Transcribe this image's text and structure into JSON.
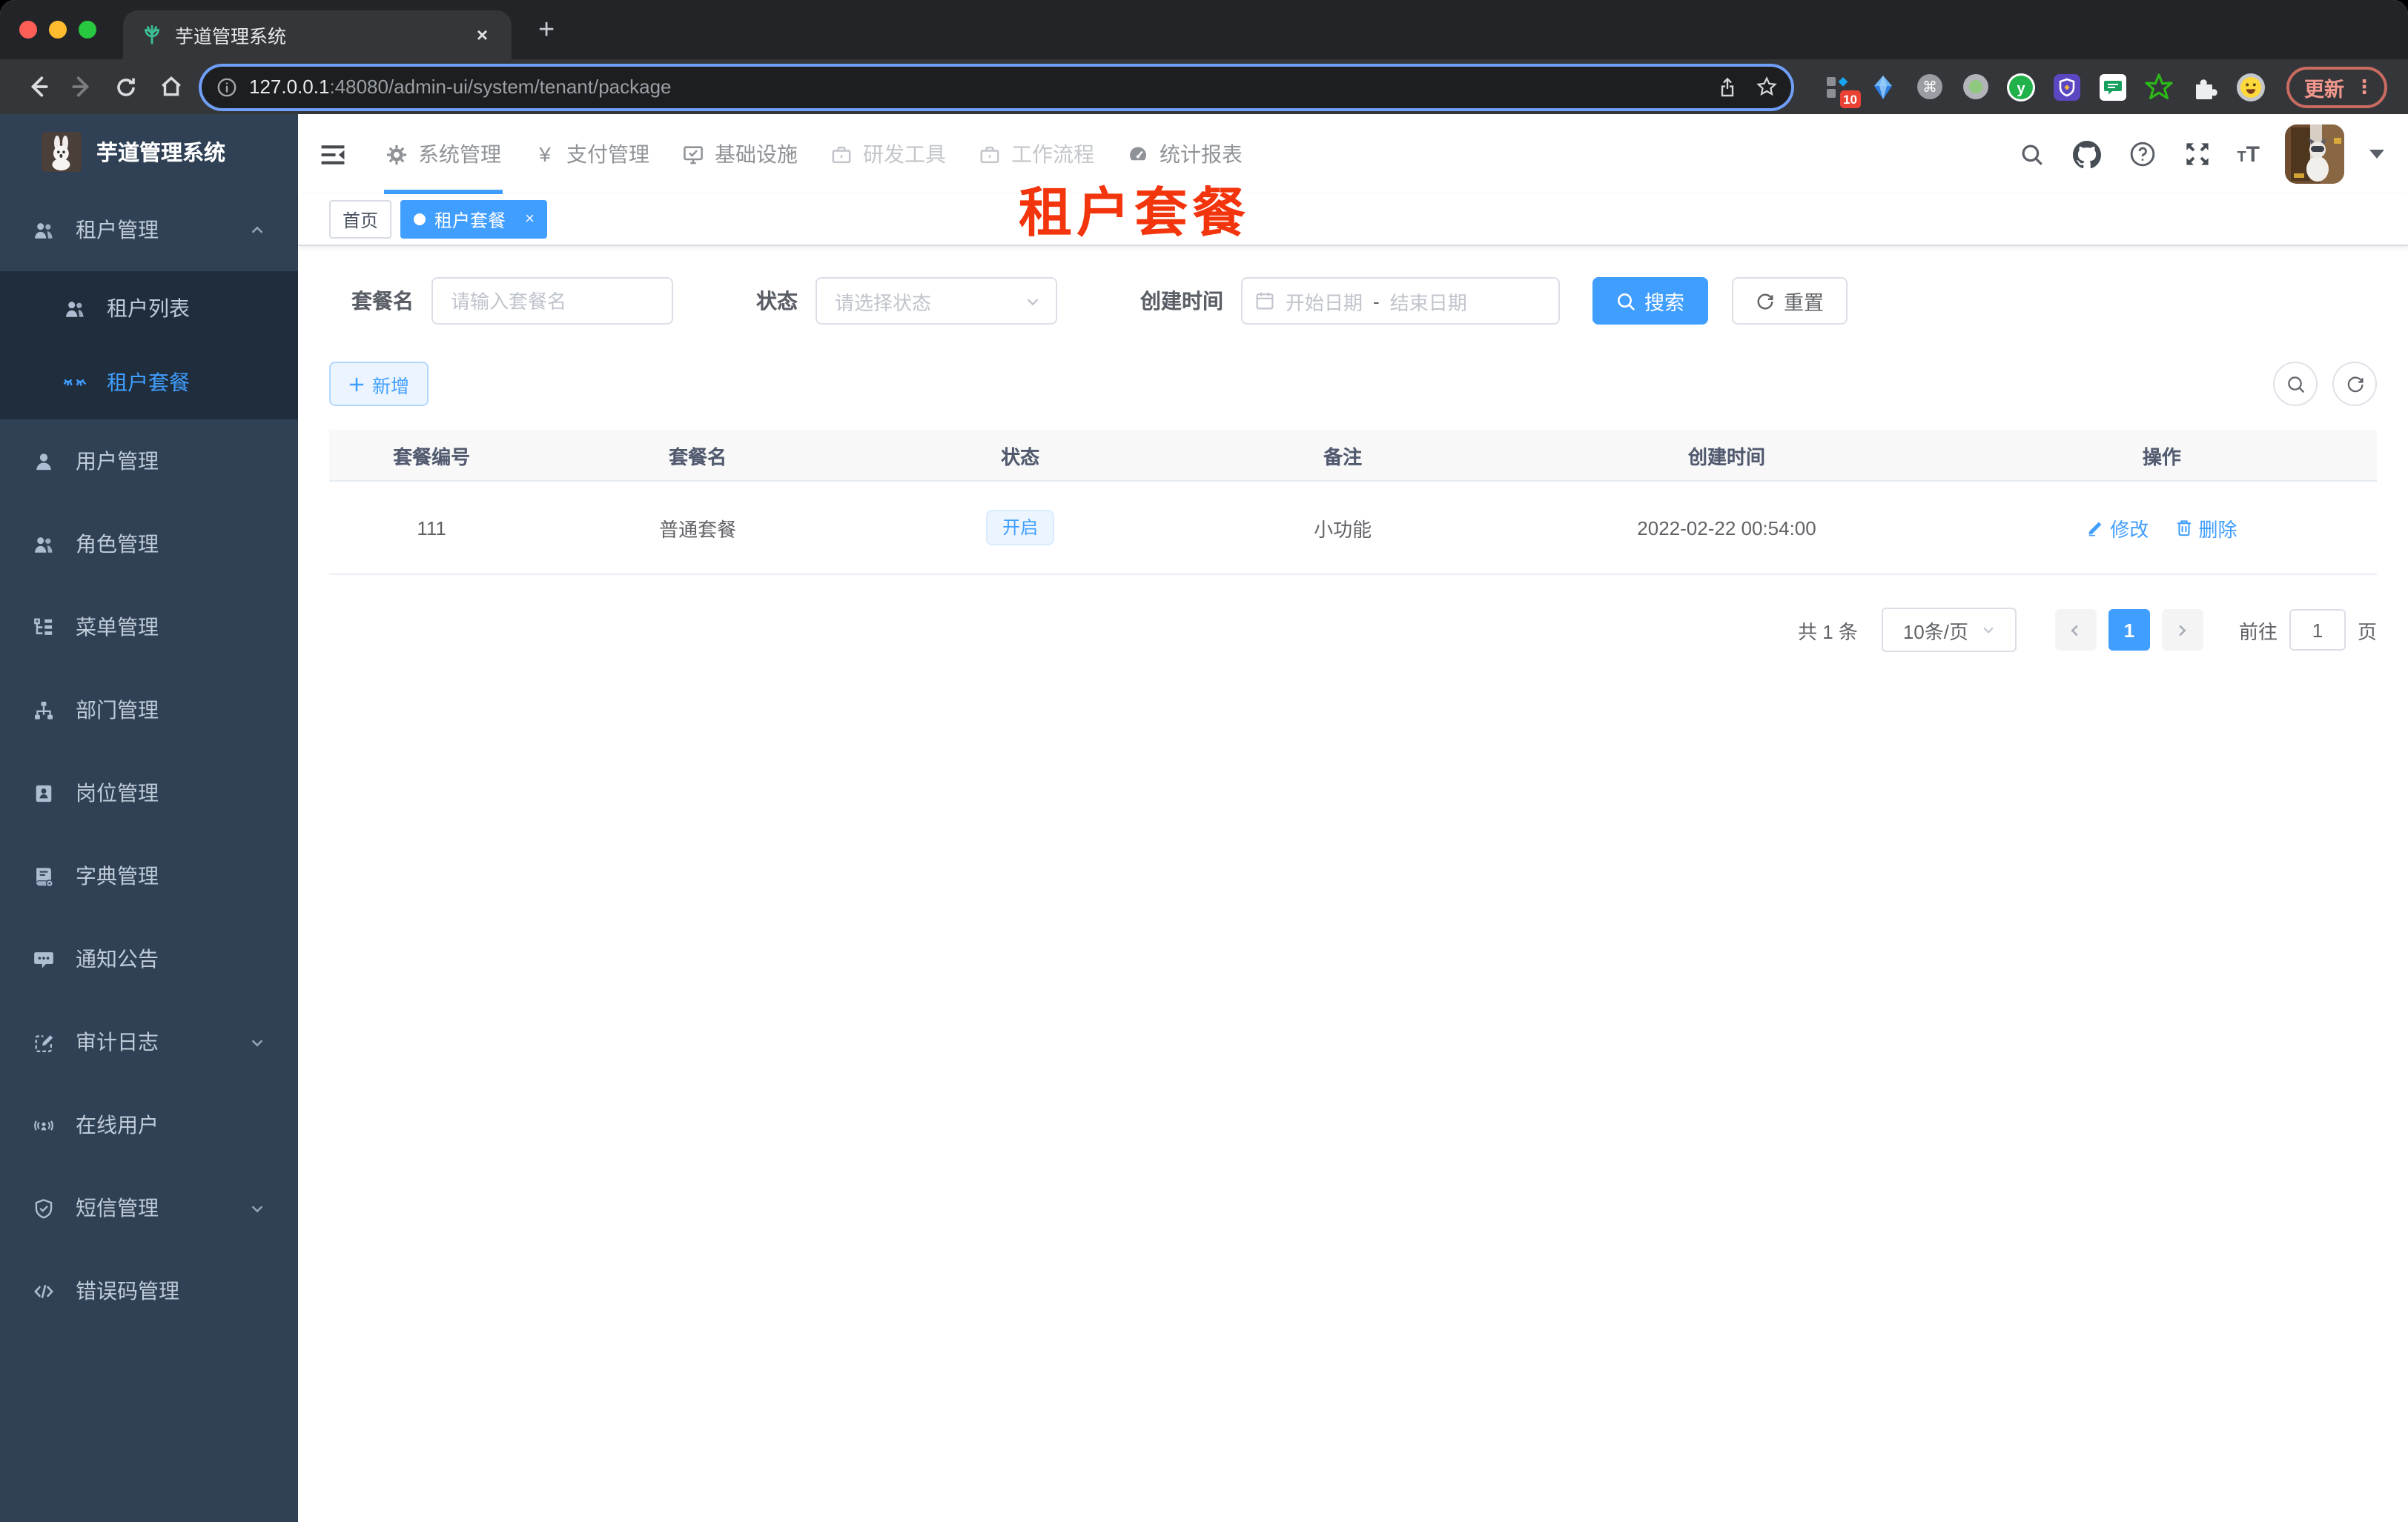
{
  "colors": {
    "accent": "#409eff",
    "sidebar_bg": "#304156",
    "sidebar_sub_bg": "#1f2d3d",
    "title_red": "#f3350d",
    "tag_active_bg": "#409eff",
    "status_tag_bg": "#ecf5ff",
    "update_pill": "#f0968c"
  },
  "browser": {
    "tab_title": "芋道管理系统",
    "close_tab": "×",
    "new_tab": "+",
    "url_host": "127.0.0.1",
    "url_rest": ":48080/admin-ui/system/tenant/package",
    "update_label": "更新",
    "menu_dots": "⋮",
    "extension_badge": "10",
    "cmd_glyph": "⌘",
    "y_glyph": "y"
  },
  "icons": {
    "favicon": "green-sprout",
    "logo": "rabbit-photo",
    "avatar": "cat-photo",
    "omnibox_left": "info-circle",
    "omnibox_right": [
      "share",
      "star"
    ],
    "extensions": [
      "tab-manager",
      "blue-gem",
      "command-circle",
      "record-circle",
      "green-y",
      "purple-shield",
      "green-chat",
      "green-star",
      "puzzle",
      "smiley"
    ],
    "navbar_right": [
      "search",
      "github",
      "help",
      "fullscreen",
      "font-size"
    ]
  },
  "sidebar": {
    "logo_title": "芋道管理系统",
    "items": [
      {
        "label": "租户管理",
        "expanded": true
      },
      {
        "label": "租户列表"
      },
      {
        "label": "租户套餐",
        "active": true
      },
      {
        "label": "用户管理"
      },
      {
        "label": "角色管理"
      },
      {
        "label": "菜单管理"
      },
      {
        "label": "部门管理"
      },
      {
        "label": "岗位管理"
      },
      {
        "label": "字典管理"
      },
      {
        "label": "通知公告"
      },
      {
        "label": "审计日志",
        "collapsible": true
      },
      {
        "label": "在线用户"
      },
      {
        "label": "短信管理",
        "collapsible": true
      },
      {
        "label": "错误码管理"
      }
    ]
  },
  "topnav": {
    "items": [
      {
        "label": "系统管理",
        "active": true
      },
      {
        "label": "支付管理"
      },
      {
        "label": "基础设施"
      },
      {
        "label": "研发工具"
      },
      {
        "label": "工作流程"
      },
      {
        "label": "统计报表"
      }
    ]
  },
  "tags": {
    "home": "首页",
    "active": "租户套餐",
    "close": "×"
  },
  "page_title": "租户套餐",
  "filters": {
    "name_label": "套餐名",
    "name_placeholder": "请输入套餐名",
    "status_label": "状态",
    "status_placeholder": "请选择状态",
    "date_label": "创建时间",
    "date_start_placeholder": "开始日期",
    "date_separator": "-",
    "date_end_placeholder": "结束日期",
    "search_label": "搜索",
    "reset_label": "重置",
    "add_label": "新增"
  },
  "table": {
    "columns": [
      "套餐编号",
      "套餐名",
      "状态",
      "备注",
      "创建时间",
      "操作"
    ],
    "rows": [
      {
        "id": "111",
        "name": "普通套餐",
        "status": "开启",
        "remark": "小功能",
        "created": "2022-02-22 00:54:00",
        "edit": "修改",
        "delete": "删除"
      }
    ]
  },
  "pagination": {
    "total": "共 1 条",
    "page_size": "10条/页",
    "current": "1",
    "goto_label": "前往",
    "goto_value": "1",
    "page_suffix": "页"
  }
}
